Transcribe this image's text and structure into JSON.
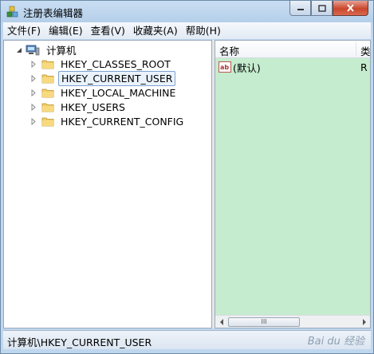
{
  "window": {
    "title": "注册表编辑器"
  },
  "menu": [
    "文件(F)",
    "编辑(E)",
    "查看(V)",
    "收藏夹(A)",
    "帮助(H)"
  ],
  "tree": {
    "root": "计算机",
    "keys": [
      {
        "label": "HKEY_CLASSES_ROOT",
        "selected": false
      },
      {
        "label": "HKEY_CURRENT_USER",
        "selected": true
      },
      {
        "label": "HKEY_LOCAL_MACHINE",
        "selected": false
      },
      {
        "label": "HKEY_USERS",
        "selected": false
      },
      {
        "label": "HKEY_CURRENT_CONFIG",
        "selected": false
      }
    ]
  },
  "list": {
    "columns": {
      "name": "名称",
      "type": "类"
    },
    "rows": [
      {
        "name": "(默认)",
        "type": "R"
      }
    ]
  },
  "scrollbar": {
    "thumb_label": "III"
  },
  "status": {
    "path": "计算机\\HKEY_CURRENT_USER",
    "watermark": "Bai du 经验"
  },
  "colors": {
    "value_pane_bg": "#c5ecce",
    "titlebar": "#bfd7ee",
    "close_button": "#c9462c"
  },
  "icons": {
    "app": "regedit-icon",
    "computer": "computer-icon",
    "key": "folder-icon",
    "value": "string-value-icon"
  }
}
